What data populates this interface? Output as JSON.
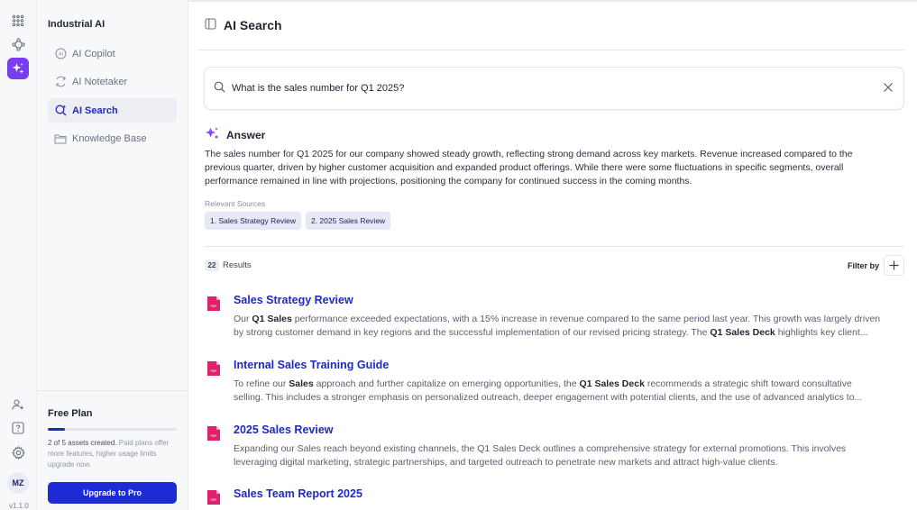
{
  "rail": {
    "icons": [
      "apps-grid-icon",
      "workflow-icon",
      "sparkles-icon"
    ],
    "bottom_icons": [
      "add-user-icon",
      "help-icon",
      "gear-icon"
    ],
    "avatar_initials": "MZ",
    "version": "v1.1.0",
    "accent": "#7a3cf0"
  },
  "sidebar": {
    "title": "Industrial AI",
    "items": [
      {
        "label": "AI Copilot",
        "icon": "ai-copilot-icon"
      },
      {
        "label": "AI Notetaker",
        "icon": "notetaker-icon"
      },
      {
        "label": "AI Search",
        "icon": "ai-search-icon",
        "active": true
      },
      {
        "label": "Knowledge Base",
        "icon": "folder-icon"
      }
    ]
  },
  "plan": {
    "title": "Free Plan",
    "used": 2,
    "total": 5,
    "usage_fraction": 0.13,
    "desc_strong": "2 of 5 assets created.",
    "desc_rest": "Paid plans offer more features, higher usage limits upgrade now.",
    "upgrade_label": "Upgrade to Pro"
  },
  "page": {
    "title": "AI Search",
    "title_icon": "sidebar-panel-icon"
  },
  "search": {
    "value": "What is the sales number for Q1 2025?",
    "placeholder": ""
  },
  "answer": {
    "label": "Answer",
    "text": "The sales number for Q1 2025 for our company showed steady growth, reflecting strong demand across key markets. Revenue increased compared to the previous quarter, driven by higher customer acquisition and expanded product offerings. While there were some fluctuations in specific segments, overall performance remained in line with projections, positioning the company for continued success in the coming months.",
    "sources_label": "Relevant Sources",
    "sources": [
      "1. Sales Strategy Review",
      "2. 2025 Sales Review"
    ]
  },
  "results": {
    "count": "22",
    "label": "Results",
    "filter_label": "Filter by",
    "items": [
      {
        "title": "Sales Strategy Review",
        "line1": [
          {
            "t": "Our "
          },
          {
            "t": "Q1 Sales",
            "b": true
          },
          {
            "t": " performance exceeded expectations, with a 15% increase in revenue compared to the same period last year. This growth was largely driven"
          }
        ],
        "line2": [
          {
            "t": "by strong customer demand in key regions and the successful implementation of our revised pricing strategy. The "
          },
          {
            "t": "Q1 Sales Deck",
            "b": true
          },
          {
            "t": " highlights key client..."
          }
        ]
      },
      {
        "title": "Internal Sales Training Guide",
        "line1": [
          {
            "t": "To refine our "
          },
          {
            "t": "Sales",
            "b": true
          },
          {
            "t": " approach and further capitalize on emerging opportunities, the "
          },
          {
            "t": "Q1 Sales Deck",
            "b": true
          },
          {
            "t": " recommends a strategic shift toward consultative"
          }
        ],
        "line2": [
          {
            "t": "selling. This includes a stronger emphasis on personalized outreach, deeper engagement with potential clients, and the use of advanced analytics to..."
          }
        ]
      },
      {
        "title": "2025 Sales Review",
        "line1": [
          {
            "t": "Expanding our Sales reach beyond existing channels, the Q1 Sales Deck outlines a comprehensive strategy for external promotions. This involves"
          }
        ],
        "line2": [
          {
            "t": "leveraging digital marketing, strategic partnerships, and targeted outreach to penetrate new markets and attract high-value clients."
          }
        ]
      },
      {
        "title": "Sales Team Report 2025",
        "line1": [],
        "line2": []
      }
    ]
  },
  "colors": {
    "brand_blue": "#1d2bbf",
    "button_blue": "#1d2bd6",
    "pdf_pink": "#e0226e",
    "sparkle_purple": "#7a3cf0"
  }
}
